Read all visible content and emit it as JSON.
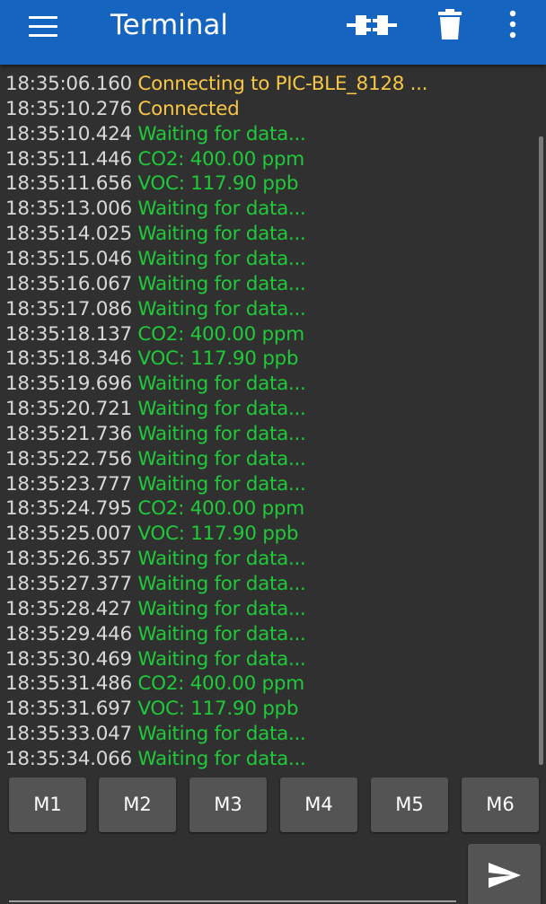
{
  "appbar": {
    "title": "Terminal",
    "background_color": "#1565c0",
    "icons": [
      "menu-icon",
      "connect-icon",
      "trash-icon",
      "more-vert-icon"
    ]
  },
  "colors": {
    "timestamp": "#d8d8d8",
    "status": "#f7c743",
    "data": "#20c93a",
    "background": "#303030",
    "button": "#545454"
  },
  "log": [
    {
      "time": "18:35:06.160",
      "message": "Connecting to PIC-BLE_8128 ...",
      "type": "status"
    },
    {
      "time": "18:35:10.276",
      "message": "Connected",
      "type": "status"
    },
    {
      "time": "18:35:10.424",
      "message": "Waiting for data...",
      "type": "data"
    },
    {
      "time": "18:35:11.446",
      "message": "CO2: 400.00 ppm",
      "type": "data"
    },
    {
      "time": "18:35:11.656",
      "message": "VOC: 117.90 ppb",
      "type": "data"
    },
    {
      "time": "18:35:13.006",
      "message": "Waiting for data...",
      "type": "data"
    },
    {
      "time": "18:35:14.025",
      "message": "Waiting for data...",
      "type": "data"
    },
    {
      "time": "18:35:15.046",
      "message": "Waiting for data...",
      "type": "data"
    },
    {
      "time": "18:35:16.067",
      "message": "Waiting for data...",
      "type": "data"
    },
    {
      "time": "18:35:17.086",
      "message": "Waiting for data...",
      "type": "data"
    },
    {
      "time": "18:35:18.137",
      "message": "CO2: 400.00 ppm",
      "type": "data"
    },
    {
      "time": "18:35:18.346",
      "message": "VOC: 117.90 ppb",
      "type": "data"
    },
    {
      "time": "18:35:19.696",
      "message": "Waiting for data...",
      "type": "data"
    },
    {
      "time": "18:35:20.721",
      "message": "Waiting for data...",
      "type": "data"
    },
    {
      "time": "18:35:21.736",
      "message": "Waiting for data...",
      "type": "data"
    },
    {
      "time": "18:35:22.756",
      "message": "Waiting for data...",
      "type": "data"
    },
    {
      "time": "18:35:23.777",
      "message": "Waiting for data...",
      "type": "data"
    },
    {
      "time": "18:35:24.795",
      "message": "CO2: 400.00 ppm",
      "type": "data"
    },
    {
      "time": "18:35:25.007",
      "message": "VOC: 117.90 ppb",
      "type": "data"
    },
    {
      "time": "18:35:26.357",
      "message": "Waiting for data...",
      "type": "data"
    },
    {
      "time": "18:35:27.377",
      "message": "Waiting for data...",
      "type": "data"
    },
    {
      "time": "18:35:28.427",
      "message": "Waiting for data...",
      "type": "data"
    },
    {
      "time": "18:35:29.446",
      "message": "Waiting for data...",
      "type": "data"
    },
    {
      "time": "18:35:30.469",
      "message": "Waiting for data...",
      "type": "data"
    },
    {
      "time": "18:35:31.486",
      "message": "CO2: 400.00 ppm",
      "type": "data"
    },
    {
      "time": "18:35:31.697",
      "message": "VOC: 117.90 ppb",
      "type": "data"
    },
    {
      "time": "18:35:33.047",
      "message": "Waiting for data...",
      "type": "data"
    },
    {
      "time": "18:35:34.066",
      "message": "Waiting for data...",
      "type": "data"
    }
  ],
  "macros": [
    "M1",
    "M2",
    "M3",
    "M4",
    "M5",
    "M6"
  ],
  "send": {
    "input_value": "",
    "icon": "send-icon"
  }
}
